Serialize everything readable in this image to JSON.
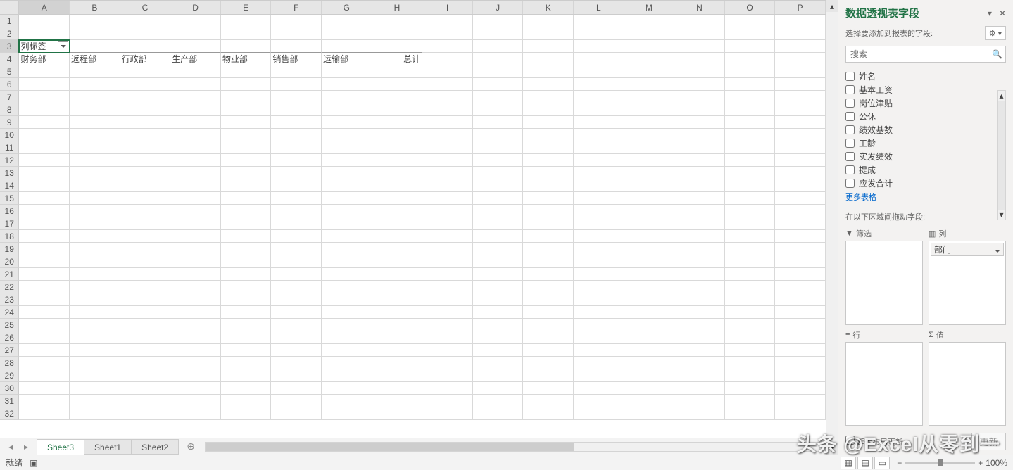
{
  "columns": [
    "A",
    "B",
    "C",
    "D",
    "E",
    "F",
    "G",
    "H",
    "I",
    "J",
    "K",
    "L",
    "M",
    "N",
    "O",
    "P"
  ],
  "rowCount": 32,
  "activeCell": {
    "row": 3,
    "col": 0
  },
  "cells": {
    "r3c0": "列标签",
    "r4c0": "财务部",
    "r4c1": "返程部",
    "r4c2": "行政部",
    "r4c3": "生产部",
    "r4c4": "物业部",
    "r4c5": "销售部",
    "r4c6": "运输部",
    "r4c7": "总计"
  },
  "sheetTabs": [
    "Sheet3",
    "Sheet1",
    "Sheet2"
  ],
  "activeTab": 0,
  "status": {
    "ready": "就绪",
    "zoom": "100%"
  },
  "pivot": {
    "title": "数据透视表字段",
    "subtitle": "选择要添加到报表的字段:",
    "searchPlaceholder": "搜索",
    "fields": [
      "姓名",
      "基本工资",
      "岗位津贴",
      "公休",
      "绩效基数",
      "工龄",
      "实发绩效",
      "提成",
      "应发合计"
    ],
    "moreTables": "更多表格",
    "dragText": "在以下区域间拖动字段:",
    "zones": {
      "filter": "筛选",
      "columns": "列",
      "rows": "行",
      "values": "值"
    },
    "columnItems": [
      "部门"
    ],
    "deferLabel": "延迟布局更新",
    "updateLabel": "更新"
  },
  "watermark": "头条 @Excel从零到一"
}
